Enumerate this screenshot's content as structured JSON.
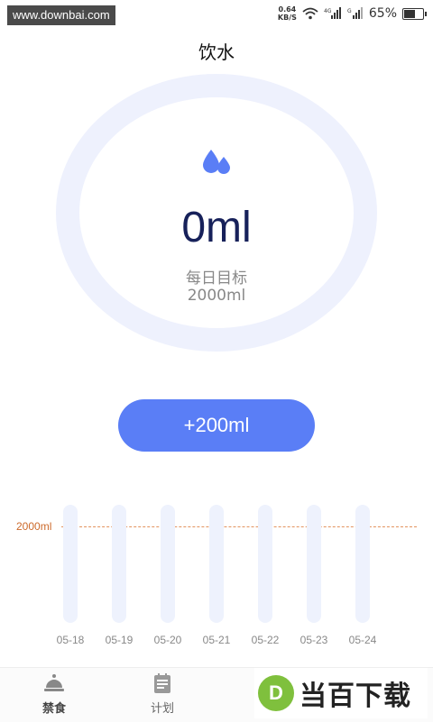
{
  "status_bar": {
    "watermark": "www.downbai.com",
    "net_speed_value": "0.64",
    "net_speed_unit": "KB/S",
    "battery_percent": "65%",
    "battery_level": 0.65
  },
  "page": {
    "title": "饮水"
  },
  "progress": {
    "current": "0ml",
    "goal_label": "每日目标",
    "goal_value": "2000ml"
  },
  "actions": {
    "add_label": "+200ml"
  },
  "chart_data": {
    "type": "bar",
    "categories": [
      "05-18",
      "05-19",
      "05-20",
      "05-21",
      "05-22",
      "05-23",
      "05-24"
    ],
    "values": [
      0,
      0,
      0,
      0,
      0,
      0,
      0
    ],
    "target_label": "2000ml",
    "target": 2000
  },
  "nav": {
    "items": [
      {
        "label": "禁食",
        "icon": "bell-jar-icon"
      },
      {
        "label": "计划",
        "icon": "notepad-icon"
      }
    ]
  },
  "brand": {
    "text": "当百下载"
  },
  "colors": {
    "accent": "#5a7ef6",
    "ring": "#eef1fd",
    "bar_track": "#eef2fd",
    "target_line": "#e3935e",
    "amount_text": "#17215a"
  }
}
